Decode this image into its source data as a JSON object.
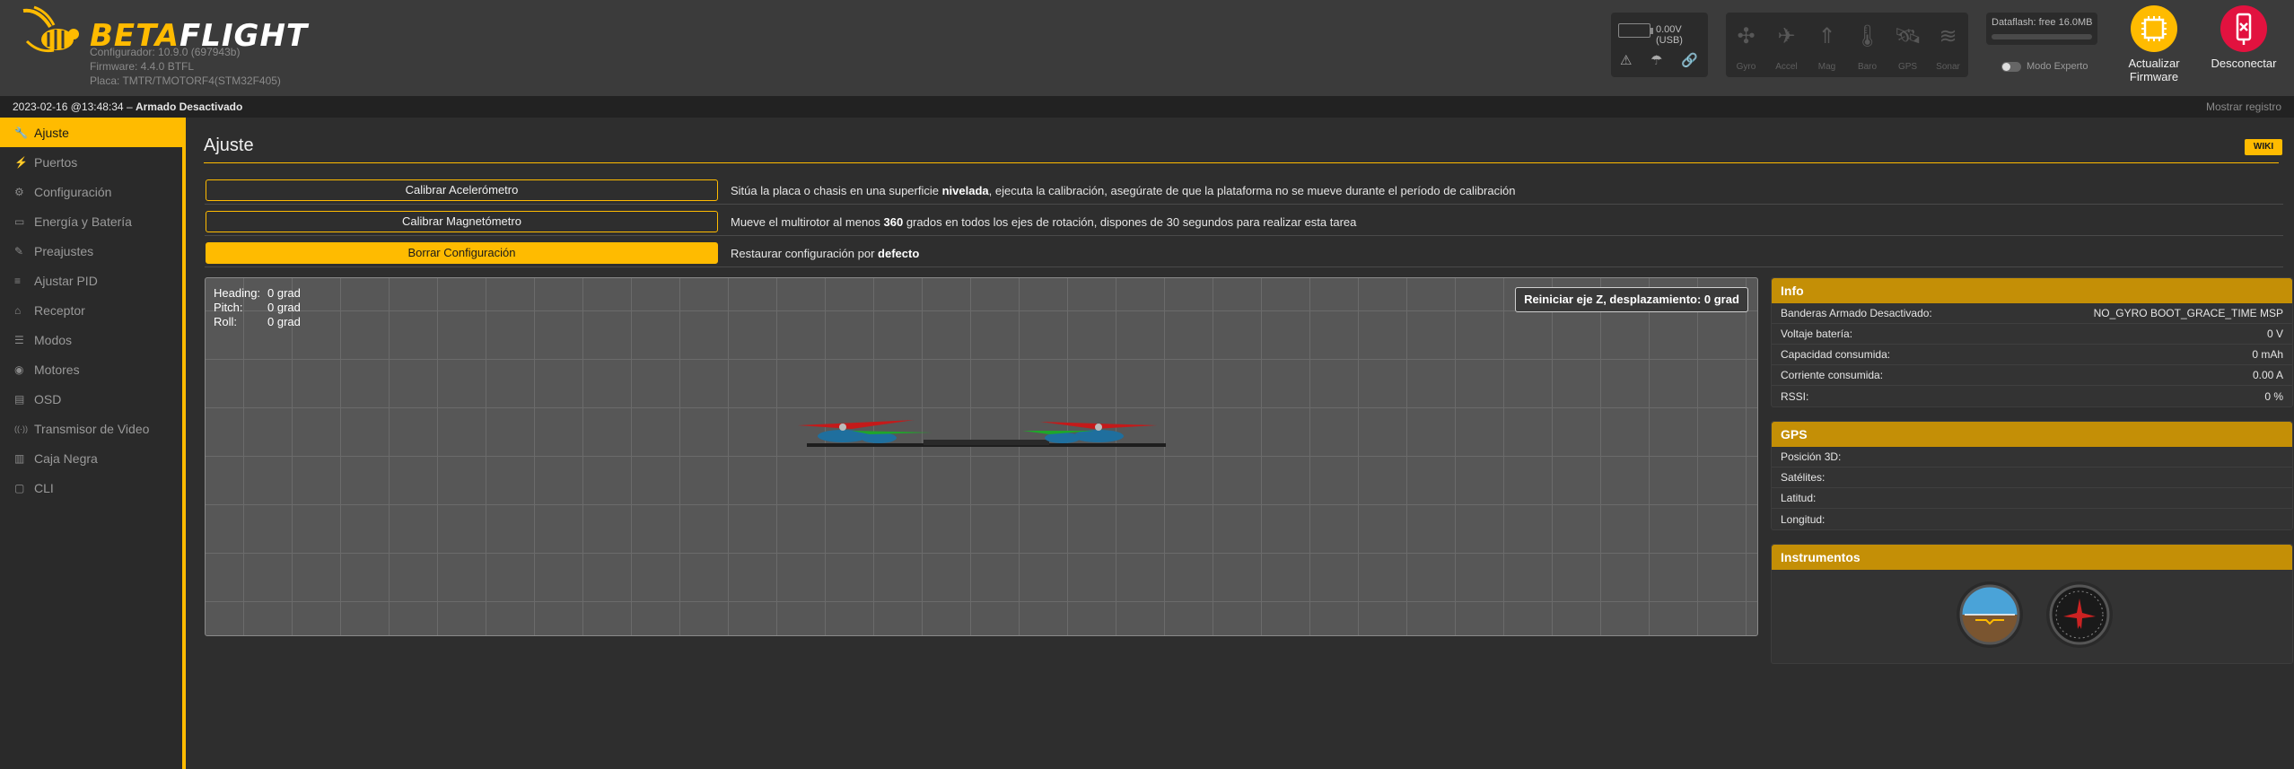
{
  "header": {
    "brand": {
      "part1": "BETA",
      "part2": "FLIGHT"
    },
    "configurator_version": "Configurador: 10.9.0 (697943b)",
    "firmware": "Firmware: 4.4.0 BTFL",
    "board": "Placa: TMTR/TMOTORF4(STM32F405)",
    "battery_text": "0.00V (USB)",
    "sensors": [
      {
        "label": "Gyro",
        "icon": "gyro-icon"
      },
      {
        "label": "Accel",
        "icon": "accel-icon"
      },
      {
        "label": "Mag",
        "icon": "mag-icon"
      },
      {
        "label": "Baro",
        "icon": "baro-icon"
      },
      {
        "label": "GPS",
        "icon": "gps-icon"
      },
      {
        "label": "Sonar",
        "icon": "sonar-icon"
      }
    ],
    "dataflash": "Dataflash: free 16.0MB",
    "expert_mode": "Modo Experto",
    "update_firmware": {
      "line1": "Actualizar",
      "line2": "Firmware"
    },
    "disconnect": "Desconectar"
  },
  "status": {
    "datetime": "2023-02-16 @13:48:34",
    "separator": " – ",
    "armed": "Armado Desactivado",
    "show_log": "Mostrar registro"
  },
  "sidebar": {
    "items": [
      {
        "label": "Ajuste",
        "icon": "wrench-icon",
        "glyph": "🔧"
      },
      {
        "label": "Puertos",
        "icon": "plug-icon",
        "glyph": "⚡"
      },
      {
        "label": "Configuración",
        "icon": "gear-icon",
        "glyph": "⚙"
      },
      {
        "label": "Energía y Batería",
        "icon": "battery-icon",
        "glyph": "▭"
      },
      {
        "label": "Preajustes",
        "icon": "tools-icon",
        "glyph": "✎"
      },
      {
        "label": "Ajustar PID",
        "icon": "sliders-icon",
        "glyph": "≡"
      },
      {
        "label": "Receptor",
        "icon": "receiver-icon",
        "glyph": "⌂"
      },
      {
        "label": "Modos",
        "icon": "modes-icon",
        "glyph": "☰"
      },
      {
        "label": "Motores",
        "icon": "motor-icon",
        "glyph": "◉"
      },
      {
        "label": "OSD",
        "icon": "osd-icon",
        "glyph": "▤"
      },
      {
        "label": "Transmisor de Video",
        "icon": "antenna-icon",
        "glyph": "((·))"
      },
      {
        "label": "Caja Negra",
        "icon": "blackbox-icon",
        "glyph": "▥"
      },
      {
        "label": "CLI",
        "icon": "terminal-icon",
        "glyph": "▢"
      }
    ]
  },
  "main": {
    "title": "Ajuste",
    "wiki": "WIKI",
    "calibration": [
      {
        "button": "Calibrar Acelerómetro",
        "desc_pre": "Sitúa la placa o chasis en una superficie ",
        "desc_bold": "nivelada",
        "desc_post": ", ejecuta la calibración, asegúrate de que la plataforma no se mueve durante el período de calibración"
      },
      {
        "button": "Calibrar Magnetómetro",
        "desc_pre": "Mueve el multirotor al menos ",
        "desc_bold": "360",
        "desc_post": " grados en todos los ejes de rotación, dispones de 30 segundos para realizar esta tarea"
      },
      {
        "button": "Borrar Configuración",
        "desc_pre": "Restaurar configuración por ",
        "desc_bold": "defecto",
        "desc_post": ""
      }
    ],
    "attitude": {
      "heading_label": "Heading:",
      "heading_value": "0 grad",
      "pitch_label": "Pitch:",
      "pitch_value": "0 grad",
      "roll_label": "Roll:",
      "roll_value": "0 grad"
    },
    "reset_z": "Reiniciar eje Z, desplazamiento: 0 grad"
  },
  "info": {
    "title": "Info",
    "rows": [
      {
        "label": "Banderas Armado Desactivado:",
        "value": "NO_GYRO  BOOT_GRACE_TIME  MSP"
      },
      {
        "label": "Voltaje batería:",
        "value": "0 V"
      },
      {
        "label": "Capacidad consumida:",
        "value": "0 mAh"
      },
      {
        "label": "Corriente consumida:",
        "value": "0.00 A"
      },
      {
        "label": "RSSI:",
        "value": "0 %"
      }
    ]
  },
  "gps": {
    "title": "GPS",
    "rows": [
      {
        "label": "Posición 3D:",
        "value": ""
      },
      {
        "label": "Satélites:",
        "value": ""
      },
      {
        "label": "Latitud:",
        "value": ""
      },
      {
        "label": "Longitud:",
        "value": ""
      }
    ]
  },
  "instruments": {
    "title": "Instrumentos"
  },
  "colors": {
    "accent": "#ffbb00",
    "disconnect": "#e2123f",
    "panel_header": "#c48f06"
  }
}
